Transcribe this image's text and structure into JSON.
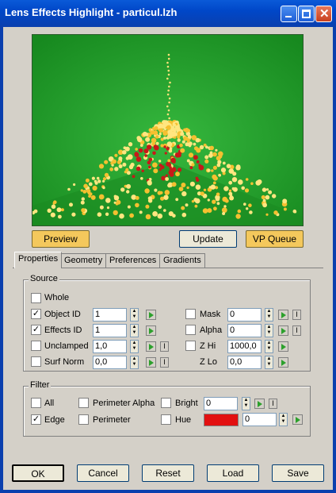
{
  "window": {
    "title": "Lens Effects Highlight - particul.lzh"
  },
  "colors": {
    "titlebar": "#0047c8",
    "preview_bg": "#1f9a2a",
    "accent_yellow": "#f4c85c",
    "hue_color": "#e21010"
  },
  "preview_buttons": {
    "preview": "Preview",
    "update": "Update",
    "vp_queue": "VP Queue"
  },
  "tabs": [
    "Properties",
    "Geometry",
    "Preferences",
    "Gradients"
  ],
  "source": {
    "label": "Source",
    "whole": "Whole",
    "object_id": {
      "label": "Object ID",
      "value": "1"
    },
    "effects_id": {
      "label": "Effects ID",
      "value": "1"
    },
    "unclamped": {
      "label": "Unclamped",
      "value": "1,0"
    },
    "surf_norm": {
      "label": "Surf Norm",
      "value": "0,0"
    },
    "mask": {
      "label": "Mask",
      "value": "0"
    },
    "alpha": {
      "label": "Alpha",
      "value": "0"
    },
    "z_hi": {
      "label": "Z Hi",
      "value": "1000,0"
    },
    "z_lo": {
      "label": "Z Lo",
      "value": "0,0"
    },
    "i_label": "I"
  },
  "filter": {
    "label": "Filter",
    "all": "All",
    "edge": "Edge",
    "perimeter_alpha": "Perimeter Alpha",
    "perimeter": "Perimeter",
    "bright": {
      "label": "Bright",
      "value": "0"
    },
    "hue": {
      "label": "Hue",
      "value": "0"
    }
  },
  "footer": {
    "ok": "OK",
    "cancel": "Cancel",
    "reset": "Reset",
    "load": "Load",
    "save": "Save"
  }
}
